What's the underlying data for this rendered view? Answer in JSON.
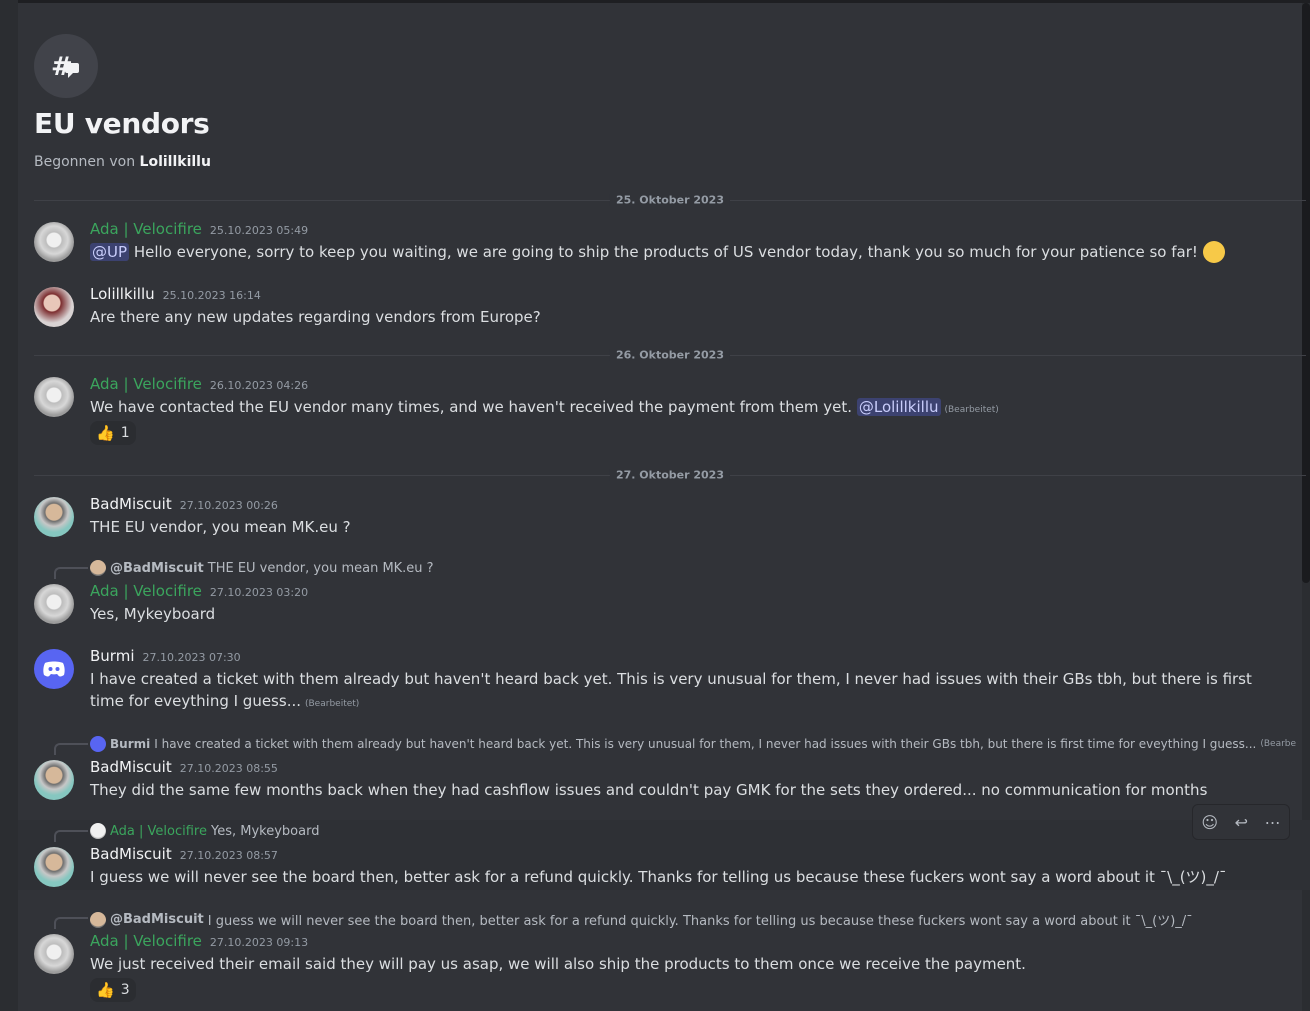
{
  "thread": {
    "title": "EU vendors",
    "started_prefix": "Begonnen von",
    "started_by": "Lolillkillu"
  },
  "dividers": [
    "25. Oktober 2023",
    "26. Oktober 2023",
    "27. Oktober 2023"
  ],
  "messages": [
    {
      "author": "Ada | Velocifire",
      "time": "25.10.2023 05:49",
      "mention": "@UP",
      "text": "Hello everyone, sorry to keep you waiting, we are going to ship the products of US vendor today, thank you so much for your patience so far!",
      "emoji": "slightly-smiling-face"
    },
    {
      "author": "Lolillkillu",
      "time": "25.10.2023 16:14",
      "text": "Are there any new updates regarding vendors from Europe?"
    },
    {
      "author": "Ada | Velocifire",
      "time": "26.10.2023 04:26",
      "text": "We have contacted the EU vendor many times, and we haven't received the payment from them yet.",
      "mention": "@Lolillkillu",
      "edited": "(Bearbeitet)",
      "reaction_count": "1"
    },
    {
      "author": "BadMiscuit",
      "time": "27.10.2023 00:26",
      "text": "THE EU vendor, you mean MK.eu ?"
    },
    {
      "author": "Ada | Velocifire",
      "time": "27.10.2023 03:20",
      "text": "Yes, Mykeyboard",
      "reply_name": "@BadMiscuit",
      "reply_text": "THE EU vendor, you mean MK.eu ?"
    },
    {
      "author": "Burmi",
      "time": "27.10.2023 07:30",
      "text": "I have created a ticket with them already but haven't heard back yet. This is very unusual for them, I never had issues with their GBs tbh, but there is first time for eveything I guess...",
      "edited": "(Bearbeitet)"
    },
    {
      "author": "BadMiscuit",
      "time": "27.10.2023 08:55",
      "text": "They did the same few months back when they had cashflow issues and couldn't pay GMK for the sets they ordered... no communication for months",
      "reply_name": "Burmi",
      "reply_text": "I have created a ticket with them already but haven't heard back yet. This is very unusual for them, I never had issues with their GBs tbh, but there is first time for eveything I guess...",
      "reply_edited": "(Bearbe"
    },
    {
      "author": "BadMiscuit",
      "time": "27.10.2023 08:57",
      "text": "I guess we will never see the board then, better ask for a refund quickly. Thanks for telling us because these fuckers wont say a word about it ¯\\_(ツ)_/¯",
      "reply_name": "Ada | Velocifire",
      "reply_text": "Yes, Mykeyboard"
    },
    {
      "author": "Ada | Velocifire",
      "time": "27.10.2023 09:13",
      "text": "We just received their email said they will pay us asap, we will also ship the products to them once we receive the payment.",
      "reply_name": "@BadMiscuit",
      "reply_text": "I guess we will never see the board then, better ask for a refund quickly. Thanks for telling us because these fuckers wont say a word about it ¯\\_(ツ)_/¯",
      "reaction_count": "3"
    }
  ],
  "colors": {
    "background": "#313338",
    "bot_name": "#3ba55d",
    "mention_bg": "#3c4270"
  },
  "icons": {
    "thread": "thread-hash-icon",
    "reaction": "thumbs-up-icon",
    "toolbar": [
      "add-reaction-icon",
      "reply-icon",
      "more-icon"
    ]
  }
}
